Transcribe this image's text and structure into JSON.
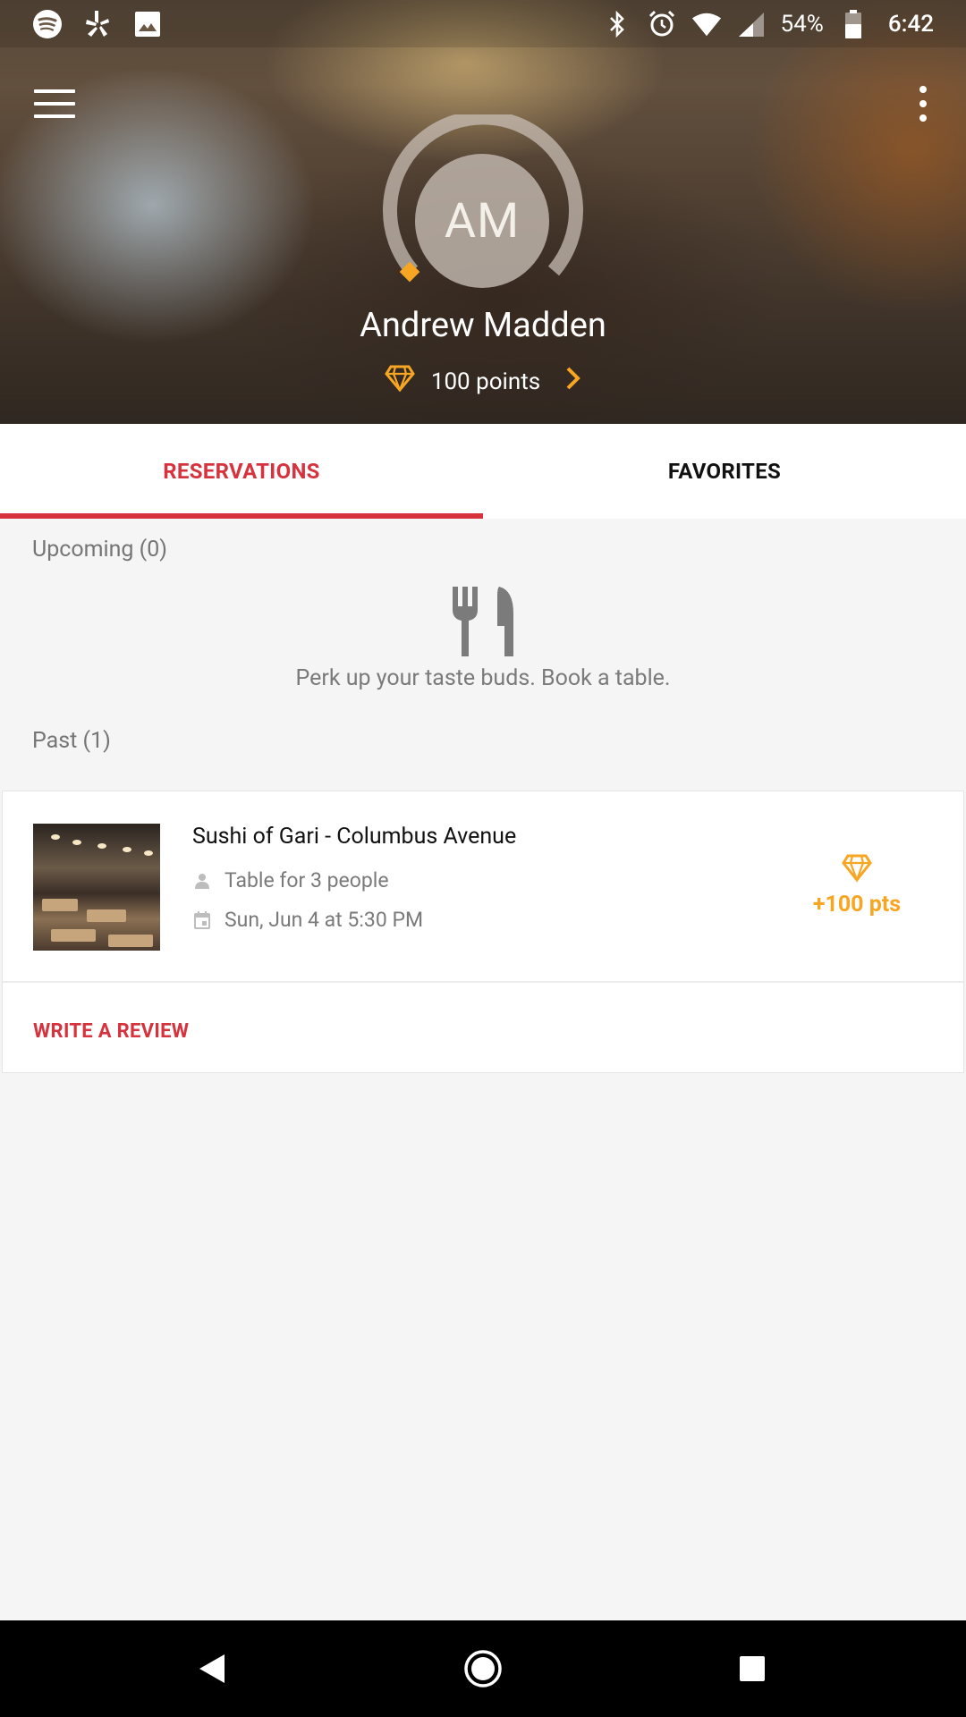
{
  "status_bar": {
    "time": "6:42",
    "battery": "54%",
    "left_icons": [
      "spotify-icon",
      "yelp-icon",
      "image-icon"
    ],
    "right_icons": [
      "bluetooth-icon",
      "alarm-icon",
      "wifi-icon",
      "signal-icon",
      "battery-icon"
    ]
  },
  "header": {
    "avatar_initials": "AM",
    "user_name": "Andrew Madden",
    "points_label": "100 points",
    "points_progress": 0.0
  },
  "tabs": [
    {
      "label": "RESERVATIONS",
      "active": true
    },
    {
      "label": "FAVORITES",
      "active": false
    }
  ],
  "upcoming": {
    "label": "Upcoming (0)",
    "empty_message": "Perk up your taste buds. Book a table."
  },
  "past": {
    "label": "Past (1)",
    "items": [
      {
        "restaurant": "Sushi of Gari - Columbus Avenue",
        "party": "Table for 3 people",
        "datetime": "Sun, Jun 4 at 5:30 PM",
        "points": "+100 pts",
        "action": "WRITE A REVIEW"
      }
    ]
  },
  "colors": {
    "accent_red": "#d7333f",
    "points_gold": "#f6a622"
  }
}
